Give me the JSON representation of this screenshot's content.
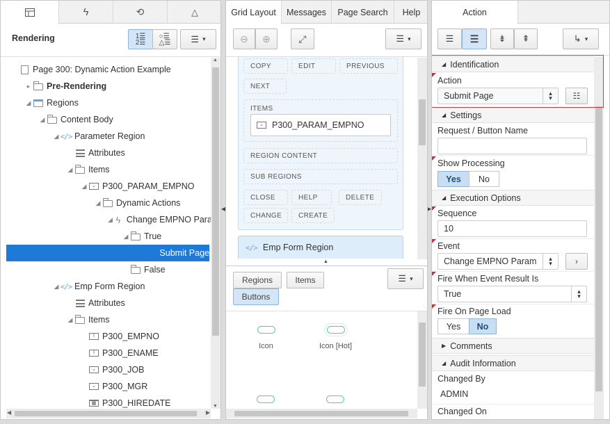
{
  "left": {
    "title": "Rendering",
    "tree": [
      {
        "label": "Page 300: Dynamic Action Example",
        "indent": 0,
        "tw": "",
        "icon": "doc",
        "bold": false
      },
      {
        "label": "Pre-Rendering",
        "indent": 1,
        "tw": "▸",
        "icon": "folder",
        "bold": true
      },
      {
        "label": "Regions",
        "indent": 1,
        "tw": "◢",
        "icon": "region",
        "bold": false
      },
      {
        "label": "Content Body",
        "indent": 2,
        "tw": "◢",
        "icon": "folder",
        "bold": false
      },
      {
        "label": "Parameter Region",
        "indent": 3,
        "tw": "◢",
        "icon": "code",
        "bold": false
      },
      {
        "label": "Attributes",
        "indent": 4,
        "tw": "",
        "icon": "list",
        "bold": false
      },
      {
        "label": "Items",
        "indent": 4,
        "tw": "◢",
        "icon": "folder",
        "bold": false
      },
      {
        "label": "P300_PARAM_EMPNO",
        "indent": 5,
        "tw": "◢",
        "icon": "select",
        "bold": false
      },
      {
        "label": "Dynamic Actions",
        "indent": 6,
        "tw": "◢",
        "icon": "folder",
        "bold": false
      },
      {
        "label": "Change EMPNO Param",
        "indent": 7,
        "tw": "◢",
        "icon": "bolt",
        "bold": false
      },
      {
        "label": "True",
        "indent": 8,
        "tw": "◢",
        "icon": "folder",
        "bold": false
      },
      {
        "label": "Submit Page",
        "indent": 9,
        "tw": "",
        "icon": "none",
        "bold": false,
        "sel": true
      },
      {
        "label": "False",
        "indent": 8,
        "tw": "",
        "icon": "folder",
        "bold": false
      },
      {
        "label": "Emp Form Region",
        "indent": 3,
        "tw": "◢",
        "icon": "code",
        "bold": false
      },
      {
        "label": "Attributes",
        "indent": 4,
        "tw": "",
        "icon": "list",
        "bold": false
      },
      {
        "label": "Items",
        "indent": 4,
        "tw": "◢",
        "icon": "folder",
        "bold": false
      },
      {
        "label": "P300_EMPNO",
        "indent": 5,
        "tw": "",
        "icon": "text",
        "bold": false
      },
      {
        "label": "P300_ENAME",
        "indent": 5,
        "tw": "",
        "icon": "text",
        "bold": false
      },
      {
        "label": "P300_JOB",
        "indent": 5,
        "tw": "",
        "icon": "select",
        "bold": false
      },
      {
        "label": "P300_MGR",
        "indent": 5,
        "tw": "",
        "icon": "select",
        "bold": false
      },
      {
        "label": "P300_HIREDATE",
        "indent": 5,
        "tw": "",
        "icon": "date",
        "bold": false
      }
    ]
  },
  "mid": {
    "tabs": [
      "Grid Layout",
      "Messages",
      "Page Search",
      "Help"
    ],
    "positions_row1": [
      "COPY",
      "EDIT",
      "PREVIOUS"
    ],
    "positions_row2": [
      "NEXT"
    ],
    "items_label": "ITEMS",
    "item_name": "P300_PARAM_EMPNO",
    "region_content": "REGION CONTENT",
    "sub_regions": "SUB REGIONS",
    "positions_row3": [
      "CLOSE",
      "HELP",
      "DELETE"
    ],
    "positions_row4": [
      "CHANGE",
      "CREATE"
    ],
    "emp_region": "Emp Form Region",
    "gallery_tabs": [
      "Regions",
      "Items",
      "Buttons"
    ],
    "gallery_items": [
      "Icon",
      "Icon [Hot]"
    ]
  },
  "right": {
    "tab": "Action",
    "sections": {
      "identification": "Identification",
      "settings": "Settings",
      "execution": "Execution Options",
      "comments": "Comments",
      "audit": "Audit Information"
    },
    "action_label": "Action",
    "action_value": "Submit Page",
    "request_label": "Request / Button Name",
    "request_value": "",
    "show_processing_label": "Show Processing",
    "yes": "Yes",
    "no": "No",
    "sequence_label": "Sequence",
    "sequence_value": "10",
    "event_label": "Event",
    "event_value": "Change EMPNO Param",
    "fire_result_label": "Fire When Event Result Is",
    "fire_result_value": "True",
    "fire_load_label": "Fire On Page Load",
    "changed_by_label": "Changed By",
    "changed_by_value": "ADMIN",
    "changed_on_label": "Changed On"
  },
  "colors": {
    "selection": "#1e7ad6",
    "highlight_border": "#d33",
    "accent_button": "#d3e5f6"
  }
}
